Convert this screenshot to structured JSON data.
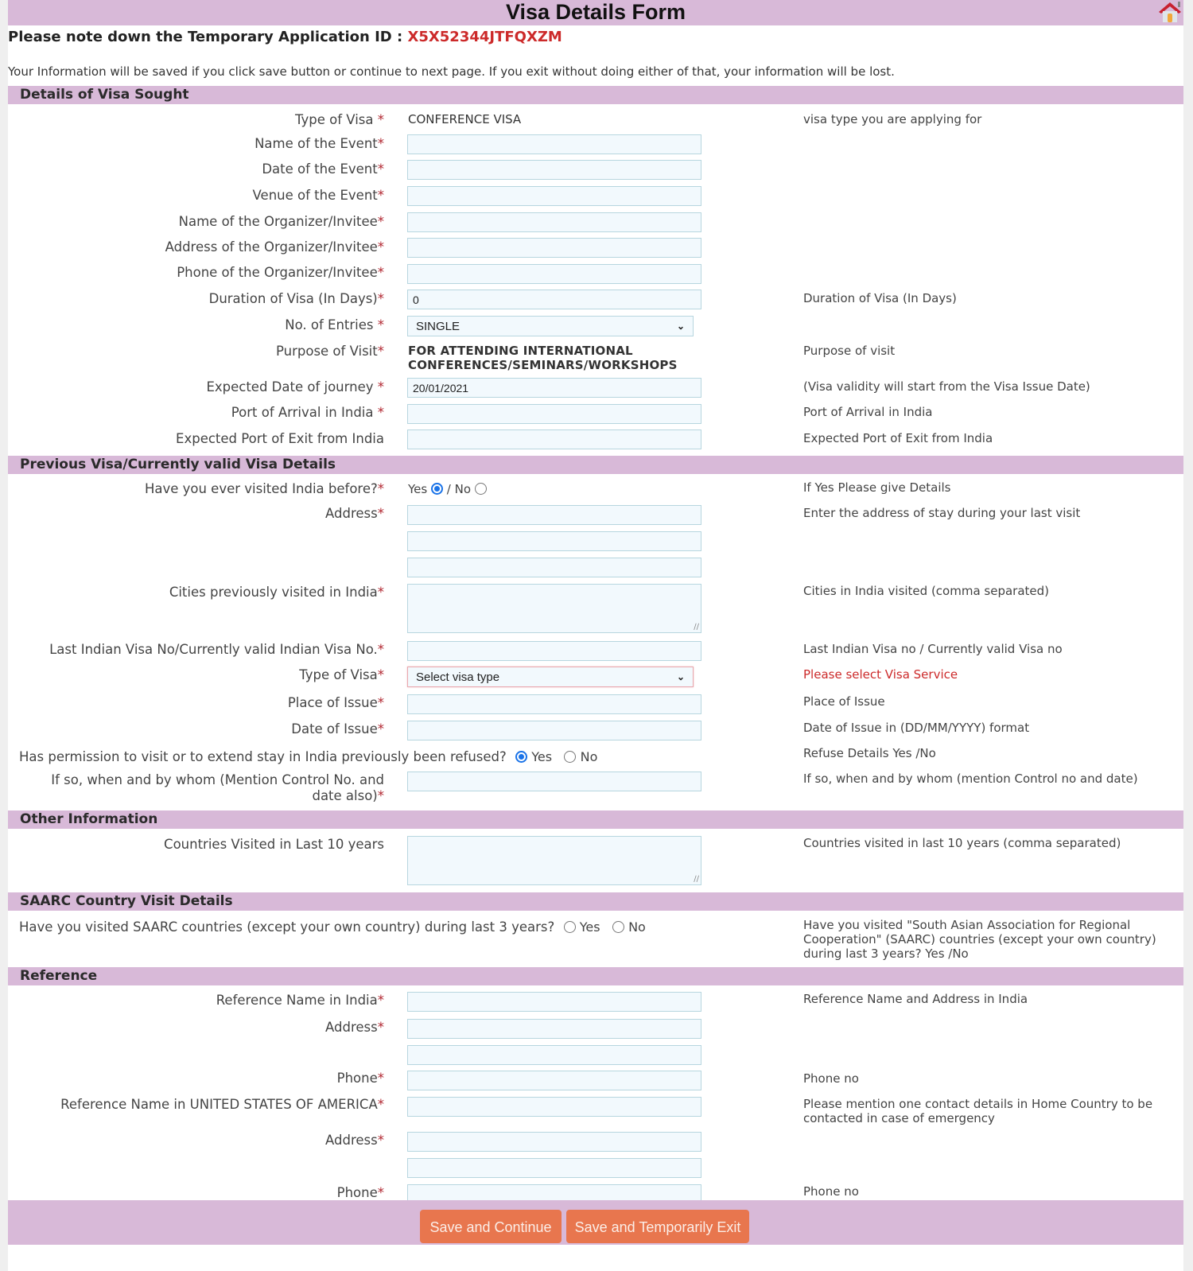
{
  "header": {
    "title": "Visa Details Form",
    "home_icon": "home-icon",
    "appid_prefix": "Please note down the Temporary Application ID : ",
    "appid": "X5X52344JTFQXZM",
    "info": "Your Information will be saved if you click save button or continue to next page. If you exit without doing either of that, your information will be lost."
  },
  "sections": {
    "visa_sought": {
      "title": "Details of Visa Sought",
      "type_of_visa": {
        "label": "Type of Visa ",
        "value": "CONFERENCE VISA",
        "hint": "visa type you are applying for"
      },
      "event_name": {
        "label": "Name of the Event",
        "value": ""
      },
      "event_date": {
        "label": "Date of the Event",
        "value": ""
      },
      "event_venue": {
        "label": "Venue of the Event",
        "value": ""
      },
      "organizer_name": {
        "label": "Name of the Organizer/Invitee",
        "value": ""
      },
      "organizer_address": {
        "label": "Address of the Organizer/Invitee",
        "value": ""
      },
      "organizer_phone": {
        "label": "Phone of the Organizer/Invitee",
        "value": ""
      },
      "duration": {
        "label": "Duration of Visa (In Days)",
        "value": "0",
        "hint": "Duration of Visa (In Days)"
      },
      "entries": {
        "label": "No. of Entries ",
        "value": "SINGLE"
      },
      "purpose": {
        "label": "Purpose of Visit",
        "value_line1": "FOR ATTENDING INTERNATIONAL",
        "value_line2": "CONFERENCES/SEMINARS/WORKSHOPS",
        "hint": "Purpose of visit"
      },
      "journey_date": {
        "label": "Expected Date of journey ",
        "value": "20/01/2021",
        "hint": "(Visa validity will start from the Visa Issue Date)"
      },
      "port_arrival": {
        "label": "Port of Arrival in India ",
        "value": "",
        "hint": "Port of Arrival in India"
      },
      "port_exit": {
        "label": "Expected Port of Exit from India",
        "value": "",
        "hint": "Expected Port of Exit from India"
      }
    },
    "previous_visa": {
      "title": "Previous Visa/Currently valid Visa Details",
      "visited_before": {
        "label": "Have you ever visited India before?",
        "yes": "Yes",
        "sep": " / ",
        "no": "No",
        "selected": "Yes",
        "hint": "If Yes Please give Details"
      },
      "address": {
        "label": "Address",
        "hint": "Enter the address of stay during your last visit",
        "lines": [
          "",
          "",
          ""
        ]
      },
      "cities": {
        "label": "Cities previously visited in India",
        "value": "",
        "hint": "Cities in India visited (comma separated)"
      },
      "last_visa_no": {
        "label": "Last Indian Visa No/Currently valid Indian Visa No.",
        "value": "",
        "hint": "Last Indian Visa no / Currently valid Visa no"
      },
      "visa_type": {
        "label": "Type of Visa",
        "value": "Select visa type",
        "hint": "Please select Visa Service"
      },
      "place_issue": {
        "label": "Place of Issue",
        "value": "",
        "hint": "Place of Issue"
      },
      "date_issue": {
        "label": "Date of Issue",
        "value": "",
        "hint": "Date of Issue in (DD/MM/YYYY) format"
      },
      "refused": {
        "label": "Has permission to visit or to extend stay in India previously been refused?",
        "yes": "Yes",
        "no": "No",
        "selected": "Yes",
        "hint": "Refuse Details Yes /No"
      },
      "refused_details": {
        "label_line1": "If so, when and by whom (Mention Control No. and",
        "label_line2": "date also)",
        "value": "",
        "hint": "If so, when and by whom (mention Control no and date)"
      }
    },
    "other_info": {
      "title": "Other Information",
      "countries": {
        "label": "Countries Visited in Last 10 years",
        "value": "",
        "hint": "Countries visited in last 10 years (comma separated)"
      }
    },
    "saarc": {
      "title": "SAARC Country Visit Details",
      "question": {
        "label": "Have you visited SAARC countries (except your own country) during last 3 years?",
        "yes": "Yes",
        "no": "No",
        "selected": "",
        "hint": "Have you visited \"South Asian Association for Regional Cooperation\" (SAARC) countries (except your own country) during last 3 years? Yes /No"
      }
    },
    "reference": {
      "title": "Reference",
      "india_name": {
        "label": "Reference Name in India",
        "value": "",
        "hint": "Reference Name and Address in India"
      },
      "india_address": {
        "label": "Address",
        "lines": [
          "",
          ""
        ]
      },
      "india_phone": {
        "label": "Phone",
        "value": "",
        "hint": "Phone no"
      },
      "home_name": {
        "label": "Reference Name in UNITED STATES OF AMERICA",
        "value": "",
        "hint": "Please mention one contact details in Home Country to be contacted in case of emergency"
      },
      "home_address": {
        "label": "Address",
        "lines": [
          "",
          ""
        ]
      },
      "home_phone": {
        "label": "Phone",
        "value": "",
        "hint": "Phone no"
      }
    }
  },
  "buttons": {
    "save_continue": "Save and Continue",
    "save_exit": "Save and Temporarily Exit"
  },
  "required_mark": "*",
  "colors": {
    "header_bg": "#d8b9d8",
    "accent_red": "#cc2a2a",
    "button": "#e8764e",
    "radio": "#1a73e8"
  }
}
